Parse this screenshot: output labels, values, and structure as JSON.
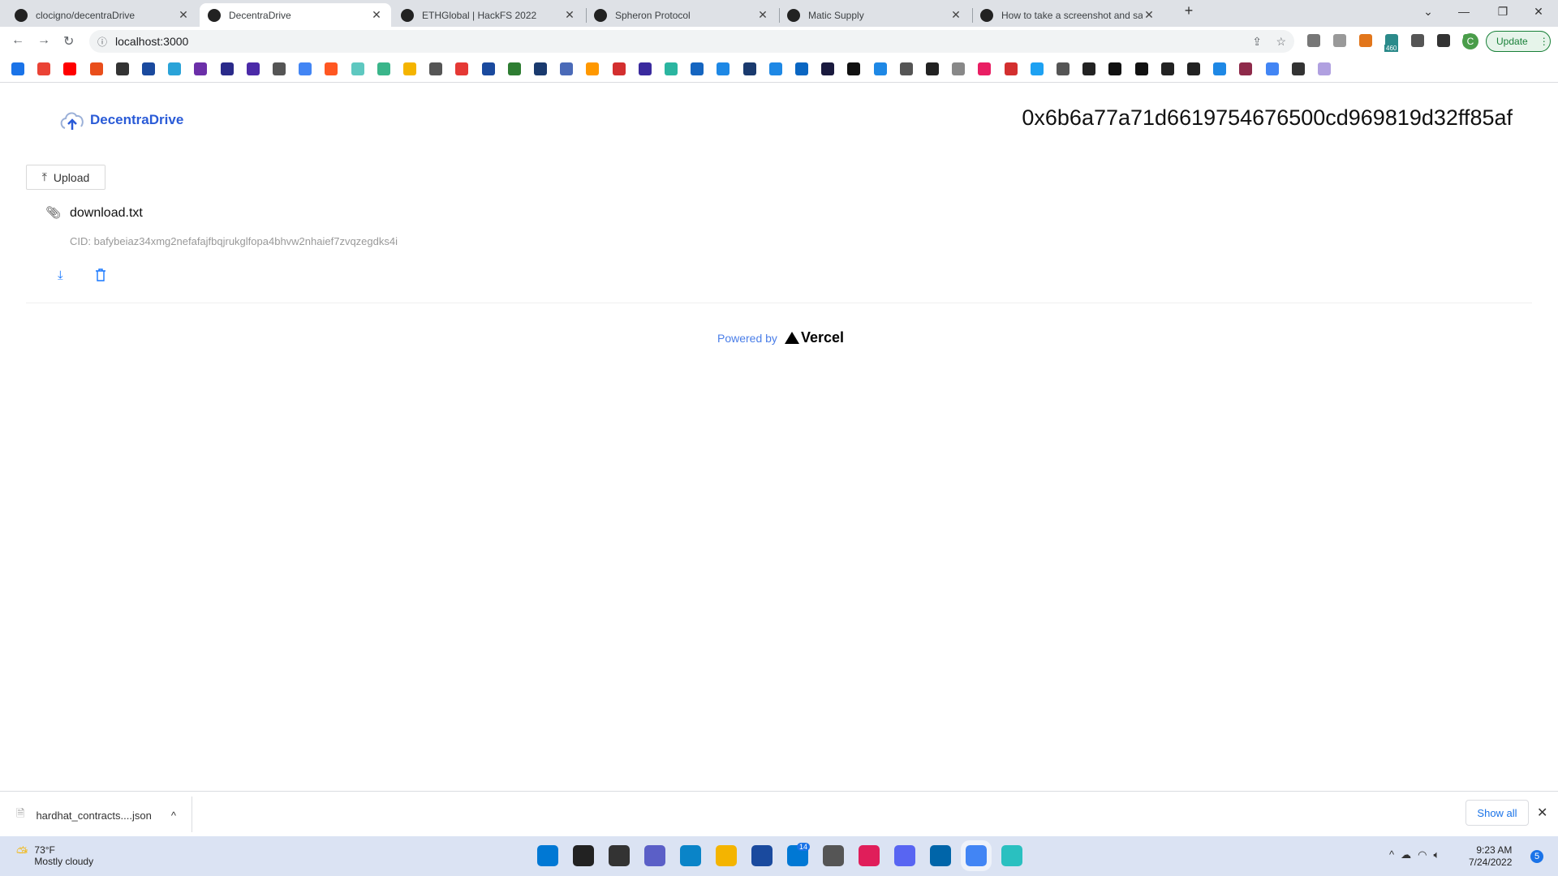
{
  "browser": {
    "tabs": [
      {
        "title": "clocigno/decentraDrive",
        "icon": "github-icon",
        "active": false
      },
      {
        "title": "DecentraDrive",
        "icon": "vercel-icon",
        "active": true
      },
      {
        "title": "ETHGlobal | HackFS 2022",
        "icon": "ethglobal-icon",
        "active": false
      },
      {
        "title": "Spheron Protocol",
        "icon": "spheron-icon",
        "active": false
      },
      {
        "title": "Matic Supply",
        "icon": "polygon-icon",
        "active": false
      },
      {
        "title": "How to take a screenshot and sa",
        "icon": "google-icon",
        "active": false
      }
    ],
    "url": "localhost:3000",
    "update_label": "Update",
    "profile_initial": "C",
    "extension_badge": "460",
    "extension_colors": [
      "#777",
      "#999",
      "#e2761b",
      "#2b8a8a",
      "#555",
      "#333",
      "#4a9d4a"
    ],
    "bookmark_colors": [
      "#1a73e8",
      "#ea4335",
      "#ff0000",
      "#e94e1b",
      "#333",
      "#1a4a9e",
      "#2aa3d8",
      "#6b2fa8",
      "#2a2a8a",
      "#4b2aa8",
      "#555",
      "#4285f4",
      "#ff5722",
      "#5ec8c0",
      "#3ab58a",
      "#f4b400",
      "#555",
      "#e53935",
      "#1a4a9e",
      "#2e7d32",
      "#1a3a6e",
      "#4a6ab8",
      "#ff9800",
      "#d32f2f",
      "#3a2a9e",
      "#2bb5a0",
      "#1565c0",
      "#1e88e5",
      "#1a3a6e",
      "#1e88e5",
      "#0a66c2",
      "#1a1a3e",
      "#111",
      "#1e88e5",
      "#555",
      "#222",
      "#888",
      "#e91e63",
      "#d32f2f",
      "#1da1f2",
      "#555",
      "#222",
      "#111",
      "#111",
      "#222",
      "#222",
      "#1e88e5",
      "#8e2a4a",
      "#4285f4",
      "#333",
      "#b0a0e0"
    ]
  },
  "app": {
    "brand": "DecentraDrive",
    "brand_color": "#2a5bd7",
    "wallet_address": "0x6b6a77a71d6619754676500cd969819d32ff85af",
    "upload_label": "Upload",
    "files": [
      {
        "name": "download.txt",
        "cid": "CID: bafybeiaz34xmg2nefafajfbqjrukglfopa4bhvw2nhaief7zvqzegdks4i"
      }
    ],
    "footer": {
      "powered_by": "Powered by",
      "vercel": "Vercel"
    }
  },
  "downloads": {
    "file": "hardhat_contracts....json",
    "show_all": "Show all"
  },
  "taskbar": {
    "temp": "73°F",
    "weather": "Mostly cloudy",
    "apps_colors": [
      "#0078d4",
      "#222",
      "#333",
      "#5b5fc7",
      "#0a84c8",
      "#f4b400",
      "#1a4a9e",
      "#0078d4",
      "#555",
      "#e01e5a",
      "#5865f2",
      "#0065a9",
      "#4285f4",
      "#2ac0c0"
    ],
    "mail_badge": "14",
    "time": "9:23 AM",
    "date": "7/24/2022",
    "notifications": "5"
  }
}
